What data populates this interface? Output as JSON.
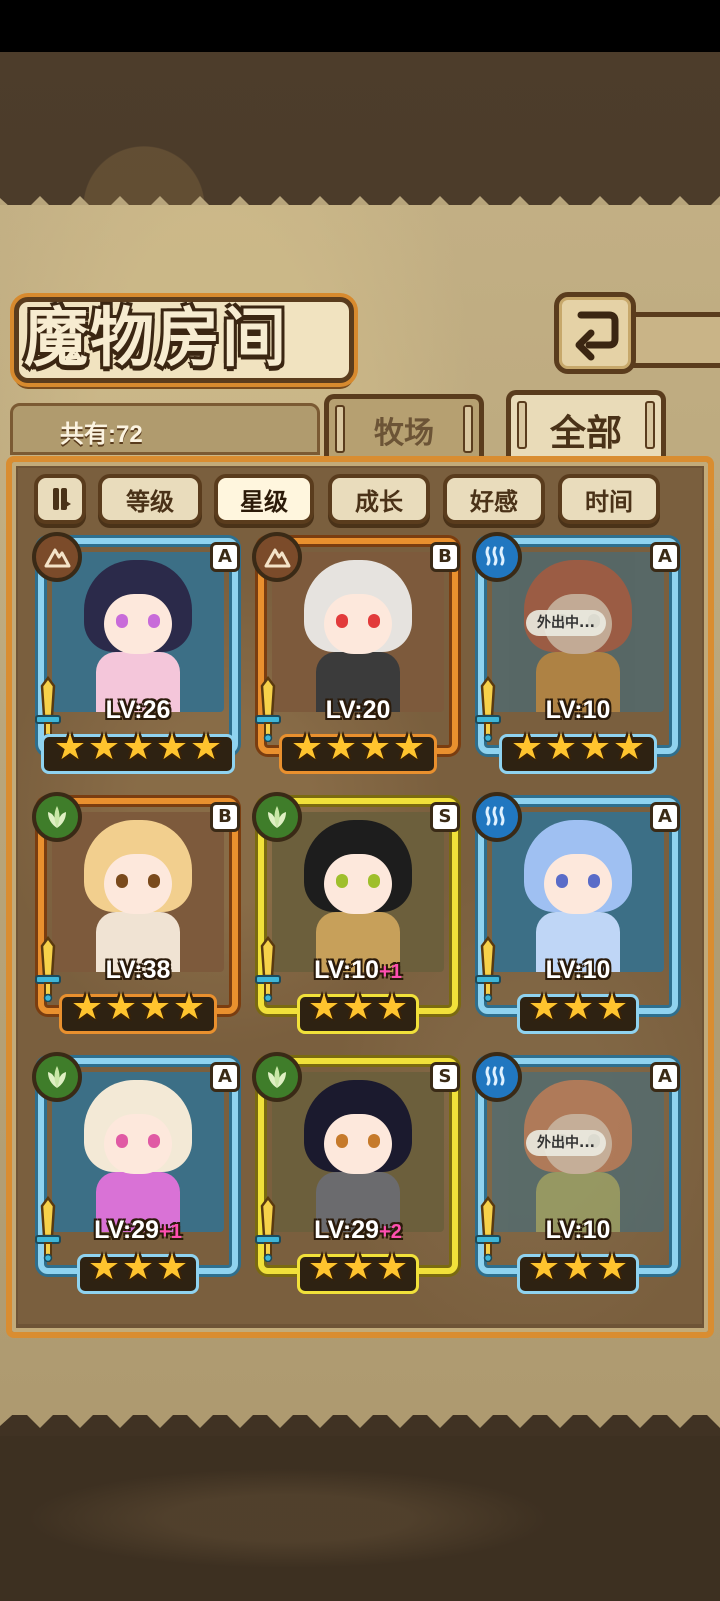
{
  "screen": {
    "title": "魔物房间",
    "count_label": "共有:72",
    "tabs": [
      {
        "label": "牧场",
        "active": false
      },
      {
        "label": "全部",
        "active": true
      }
    ],
    "sort_buttons": [
      {
        "label": "等级",
        "active": false
      },
      {
        "label": "星级",
        "active": true
      },
      {
        "label": "成长",
        "active": false
      },
      {
        "label": "好感",
        "active": false
      },
      {
        "label": "时间",
        "active": false
      }
    ]
  },
  "monsters": [
    {
      "level": "LV:26",
      "plus": "",
      "stars": 5,
      "rank": "A",
      "element": "earth-icon",
      "frame": "blue",
      "away": false,
      "hair": "#2b2a4a",
      "eye": "#c86bd9",
      "body": "#f4c6da"
    },
    {
      "level": "LV:20",
      "plus": "",
      "stars": 4,
      "rank": "B",
      "element": "earth-icon",
      "frame": "orange",
      "away": false,
      "hair": "#e6e3df",
      "eye": "#e23b3b",
      "body": "#3b3b3b"
    },
    {
      "level": "LV:10",
      "plus": "",
      "stars": 4,
      "rank": "A",
      "element": "water-icon",
      "frame": "blue",
      "away": true,
      "away_label": "外出中...",
      "hair": "#b75a49",
      "eye": "#333",
      "body": "#d9a04a"
    },
    {
      "level": "LV:38",
      "plus": "",
      "stars": 4,
      "rank": "B",
      "element": "leaf-icon",
      "frame": "orange",
      "away": false,
      "hair": "#f2cf8e",
      "eye": "#7a4a1c",
      "body": "#f0e3d3"
    },
    {
      "level": "LV:10",
      "plus": "+1",
      "stars": 3,
      "rank": "S",
      "element": "leaf-icon",
      "frame": "yellow",
      "away": false,
      "hair": "#1d1d1d",
      "eye": "#9fbf2c",
      "body": "#c7a05a"
    },
    {
      "level": "LV:10",
      "plus": "",
      "stars": 3,
      "rank": "A",
      "element": "water-icon",
      "frame": "blue",
      "away": false,
      "hair": "#9fc0f2",
      "eye": "#5a6cc8",
      "body": "#bfd6f6"
    },
    {
      "level": "LV:29",
      "plus": "+1",
      "stars": 3,
      "rank": "A",
      "element": "leaf-icon",
      "frame": "blue",
      "away": false,
      "hair": "#f3e9d6",
      "eye": "#e05aa4",
      "body": "#d972d6"
    },
    {
      "level": "LV:29",
      "plus": "+2",
      "stars": 3,
      "rank": "S",
      "element": "leaf-icon",
      "frame": "yellow",
      "away": false,
      "hair": "#1b1a2e",
      "eye": "#c67a2b",
      "body": "#6b6b6e"
    },
    {
      "level": "LV:10",
      "plus": "",
      "stars": 3,
      "rank": "A",
      "element": "water-icon",
      "frame": "blue",
      "away": true,
      "away_label": "外出中...",
      "hair": "#d58a6a",
      "eye": "#333",
      "body": "#a8c07a"
    }
  ],
  "colors": {
    "frame_blue": "#8fd3f0",
    "frame_orange": "#e9902e",
    "frame_yellow": "#f1e13a",
    "element_earth": "#7b4b2a",
    "element_leaf": "#3f7d2a",
    "element_water": "#2177c0"
  }
}
